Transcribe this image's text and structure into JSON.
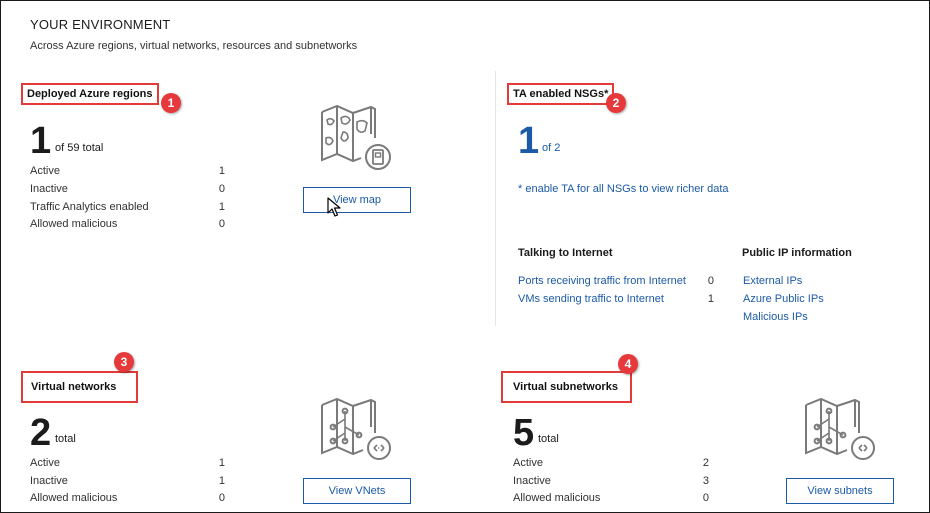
{
  "header": {
    "title": "YOUR ENVIRONMENT",
    "subtitle": "Across Azure regions, virtual networks, resources and subnetworks"
  },
  "regions": {
    "title": "Deployed Azure regions",
    "badge": "1",
    "count": "1",
    "of_total": "of 59 total",
    "rows": [
      {
        "label": "Active",
        "value": "1"
      },
      {
        "label": "Inactive",
        "value": "0"
      },
      {
        "label": "Traffic Analytics enabled",
        "value": "1"
      },
      {
        "label": "Allowed malicious",
        "value": "0"
      }
    ],
    "button": "View map",
    "icon": "map-icon"
  },
  "nsgs": {
    "title": "TA enabled NSGs*",
    "badge": "2",
    "count": "1",
    "of_total": "of 2",
    "note": "* enable TA for all NSGs to view richer data",
    "talking": {
      "header": "Talking to Internet",
      "rows": [
        {
          "label": "Ports receiving traffic from Internet",
          "value": "0"
        },
        {
          "label": "VMs sending traffic to Internet",
          "value": "1"
        }
      ]
    },
    "public_ip": {
      "header": "Public IP information",
      "links": [
        "External IPs",
        "Azure Public IPs",
        "Malicious IPs"
      ]
    }
  },
  "vnets": {
    "title": "Virtual networks",
    "badge": "3",
    "count": "2",
    "of_total": "total",
    "rows": [
      {
        "label": "Active",
        "value": "1"
      },
      {
        "label": "Inactive",
        "value": "1"
      },
      {
        "label": "Allowed malicious",
        "value": "0"
      }
    ],
    "button": "View VNets",
    "icon": "vnet-icon"
  },
  "subnets": {
    "title": "Virtual subnetworks",
    "badge": "4",
    "count": "5",
    "of_total": "total",
    "rows": [
      {
        "label": "Active",
        "value": "2"
      },
      {
        "label": "Inactive",
        "value": "3"
      },
      {
        "label": "Allowed malicious",
        "value": "0"
      }
    ],
    "button": "View subnets",
    "icon": "subnet-icon"
  },
  "colors": {
    "accent": "#1b5aa6",
    "annotation": "#e33a3a"
  }
}
